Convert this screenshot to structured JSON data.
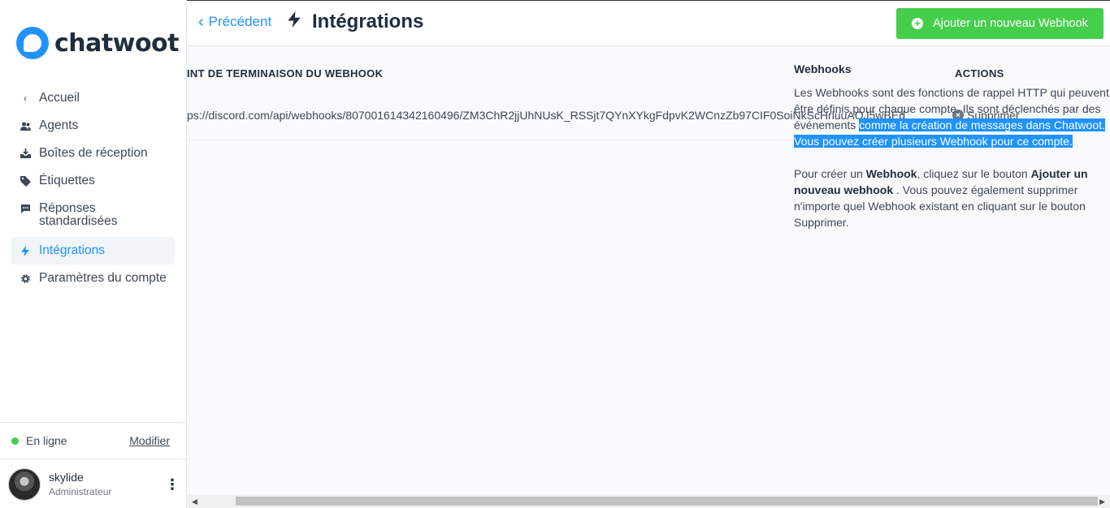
{
  "brand": {
    "name": "chatwoot",
    "accent": "#1f93ff",
    "success": "#44ce4b"
  },
  "sidebar": {
    "items": [
      {
        "label": "Accueil",
        "icon": "chevron-left-icon"
      },
      {
        "label": "Agents",
        "icon": "users-icon"
      },
      {
        "label": "Boîtes de réception",
        "icon": "inbox-icon"
      },
      {
        "label": "Étiquettes",
        "icon": "tag-icon"
      },
      {
        "label": "Réponses standardisées",
        "icon": "chat-icon"
      },
      {
        "label": "Intégrations",
        "icon": "bolt-icon",
        "active": true
      },
      {
        "label": "Paramètres du compte",
        "icon": "gear-icon"
      }
    ],
    "status": {
      "text": "En ligne",
      "edit_label": "Modifier"
    },
    "user": {
      "name": "skylide",
      "role": "Administrateur"
    }
  },
  "header": {
    "back_label": "Précédent",
    "title": "Intégrations",
    "add_button_label": "Ajouter un nouveau Webhook"
  },
  "table": {
    "columns": [
      "INT DE TERMINAISON DU WEBHOOK",
      "ACTIONS"
    ],
    "rows": [
      {
        "endpoint": "ps://discord.com/api/webhooks/807001614342160496/ZM3ChR2jjUhNUsK_RSSjt7QYnXYkgFdpvK2WCnzZb97CIF0SoiNkScHrluuAOJ5wBEd",
        "action_label": "Supprimer"
      }
    ]
  },
  "help": {
    "title": "Webhooks",
    "para1_plain": "Les Webhooks sont des fonctions de rappel HTTP qui peuvent être définis pour chaque compte. Ils sont déclenchés par des événements ",
    "para1_selected": "comme la création de messages dans Chatwoot. Vous pouvez créer plusieurs Webhook pour ce compte.",
    "para2_a": "Pour créer un ",
    "para2_b": "Webhook",
    "para2_c": ", cliquez sur le bouton ",
    "para2_d": "Ajouter un nouveau webhook",
    "para2_e": " . Vous pouvez également supprimer n'importe quel Webhook existant en cliquant sur le bouton Supprimer."
  }
}
